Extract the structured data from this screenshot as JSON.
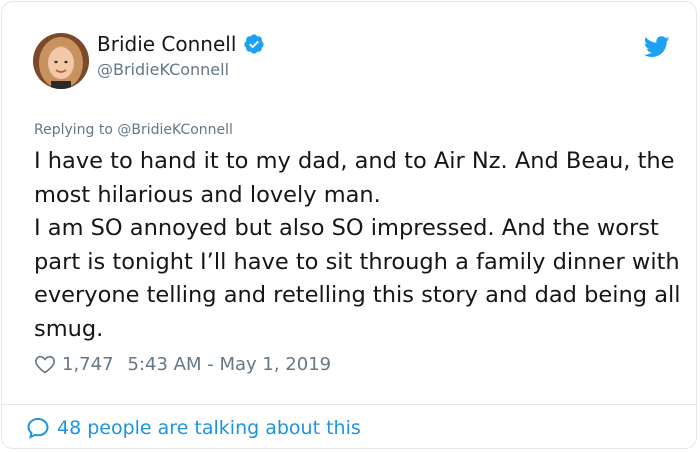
{
  "user": {
    "name": "Bridie Connell",
    "handle": "@BridieKConnell"
  },
  "reply": {
    "prefix": "Replying to",
    "target": "@BridieKConnell"
  },
  "tweet": {
    "text": "I have to hand it to my dad, and to Air Nz. And Beau, the most hilarious and lovely man.\nI am SO annoyed but also SO impressed. And the worst part is tonight I’ll have to sit through a family dinner with everyone telling and retelling this story and dad being all smug.",
    "likes": "1,747",
    "timestamp": "5:43 AM - May 1, 2019"
  },
  "footer": {
    "talking": "48 people are talking about this"
  },
  "colors": {
    "brand_blue": "#1da1f2",
    "link_blue": "#1b95e0",
    "muted": "#657786",
    "text": "#14171a"
  },
  "icons": {
    "verified": "verified-badge-icon",
    "bird": "twitter-bird-icon",
    "heart": "heart-icon",
    "bubble": "speech-bubble-icon"
  }
}
